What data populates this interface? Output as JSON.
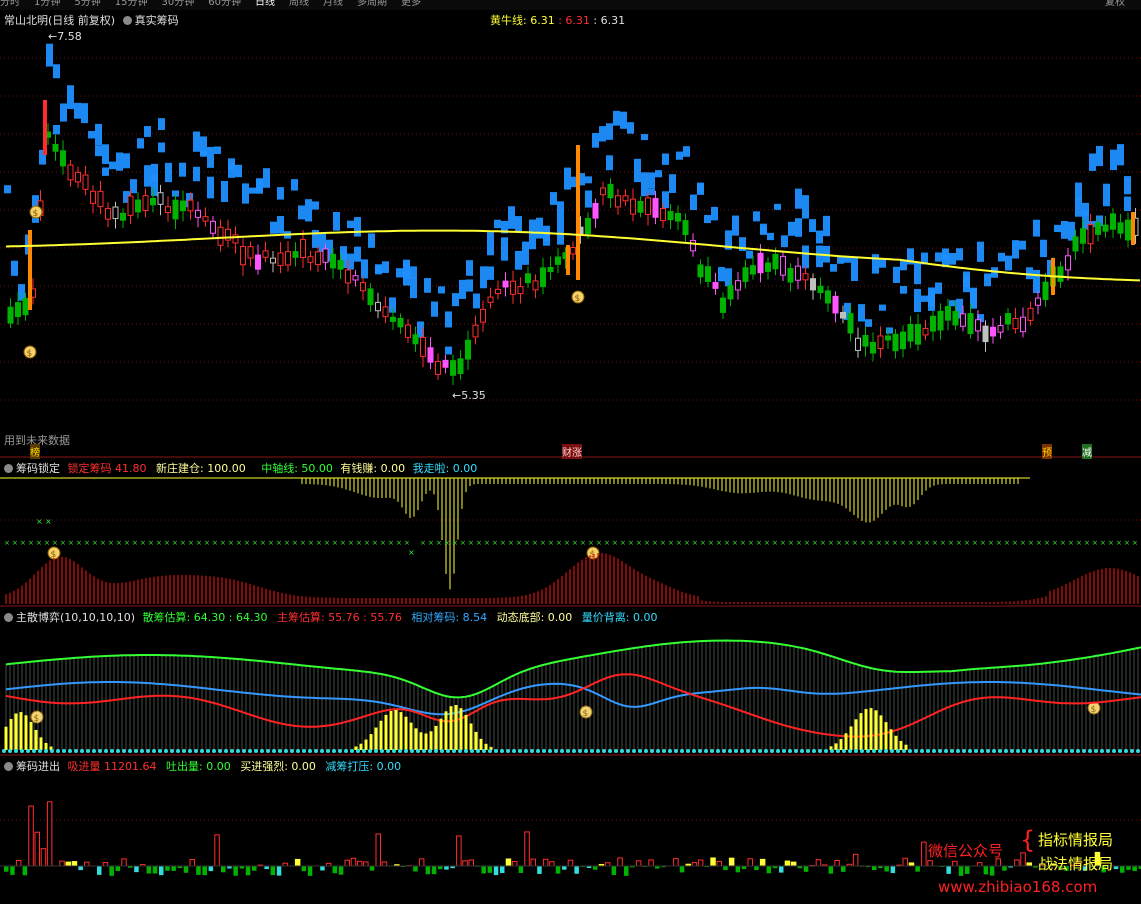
{
  "topbar": {
    "tabs": [
      "分时",
      "1分钟",
      "5分钟",
      "15分钟",
      "30分钟",
      "60分钟",
      "日线",
      "周线",
      "月线",
      "多周期",
      "更多"
    ],
    "active": "日线",
    "right": "复权"
  },
  "main": {
    "stock": "常山北明(日线 前复权)",
    "indicator": "真实筹码",
    "huangniu_label": "黄牛线: 6.31",
    "huangniu_v2": "6.31",
    "huangniu_v3": "6.31",
    "high_label": "7.58",
    "low_label": "5.35",
    "future_note": "用到未来数据",
    "tag_left": "榜",
    "tag_mid": "财涨",
    "tag_r1": "预",
    "tag_r2": "减"
  },
  "p2": {
    "name": "筹码锁定",
    "lock_label": "锁定筹码",
    "lock_value": "41.80",
    "newbuild": "新庄建仓: 100.00",
    "axis": "中轴线: 50.00",
    "money": "有钱赚: 0.00",
    "leave": "我走啦: 0.00"
  },
  "p3": {
    "name": "主散博弈(10,10,10,10)",
    "retail": "散筹估算: 64.30",
    "retail2": "64.30",
    "main_label": "主筹估算: 55.76",
    "main2": "55.76",
    "relative": "相对筹码: 8.54",
    "bottom": "动态底部: 0.00",
    "diverge": "量价背离: 0.00"
  },
  "p4": {
    "name": "筹码进出",
    "in_label": "吸进量",
    "in_value": "11201.64",
    "out": "吐出量: 0.00",
    "buy": "买进强烈: 0.00",
    "press": "减筹打压: 0.00"
  },
  "watermark": {
    "wechat": "微信公众号",
    "line1": "指标情报局",
    "line2": "战法情报局",
    "url": "www.zhibiao168.com"
  },
  "colors": {
    "up": "#ff2d2d",
    "down": "#00b300",
    "magenta": "#ff55ff",
    "blue": "#1e8fff",
    "yellow": "#ffff33",
    "green_line": "#33ff33",
    "cyan": "#33dddd",
    "grid": "#6e1010"
  }
}
